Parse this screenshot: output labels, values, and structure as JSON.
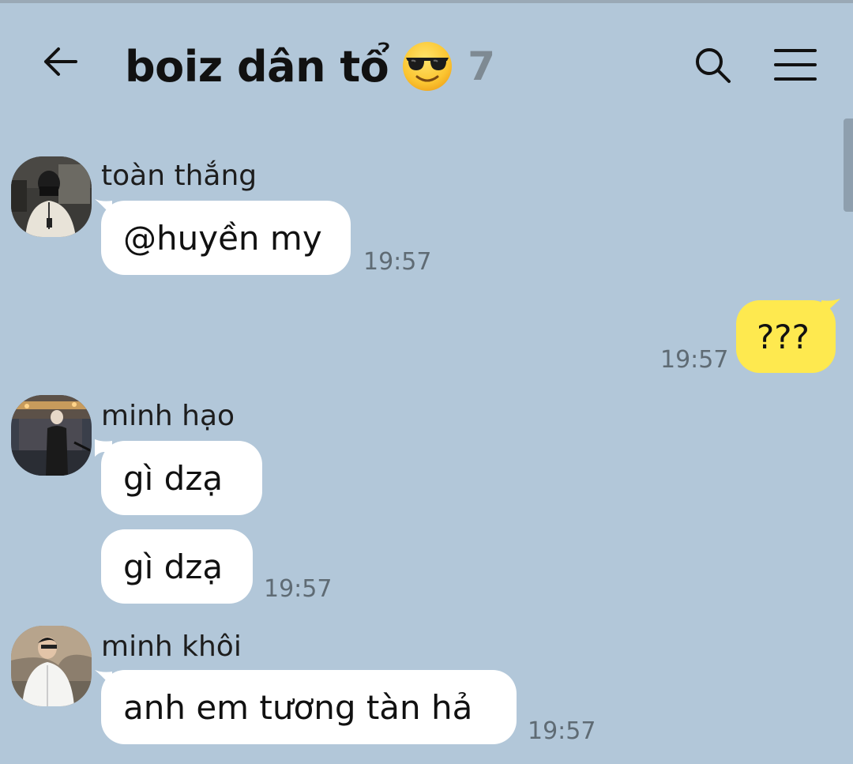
{
  "header": {
    "title": "boiz dân tổ",
    "member_count": "7"
  },
  "icons": {
    "back": "arrow-left-icon",
    "title_emoji": "sunglasses-emoji",
    "search": "search-icon",
    "menu": "hamburger-menu-icon"
  },
  "colors": {
    "background": "#b2c7d9",
    "incoming_bubble": "#ffffff",
    "outgoing_bubble": "#fee94f",
    "timestamp": "#5f6b74",
    "member_count": "#7e8a93"
  },
  "messages": [
    {
      "sender": "toàn thắng",
      "text": "@huyền my",
      "time": "19:57",
      "mine": false
    },
    {
      "sender": "",
      "text": "???",
      "time": "19:57",
      "mine": true
    },
    {
      "sender": "minh hạo",
      "text": "gì dzạ",
      "time": "",
      "mine": false
    },
    {
      "sender": "",
      "text": "gì dzạ",
      "time": "19:57",
      "mine": false
    },
    {
      "sender": "minh khôi",
      "text": "anh em tương tàn hả",
      "time": "19:57",
      "mine": false
    }
  ]
}
